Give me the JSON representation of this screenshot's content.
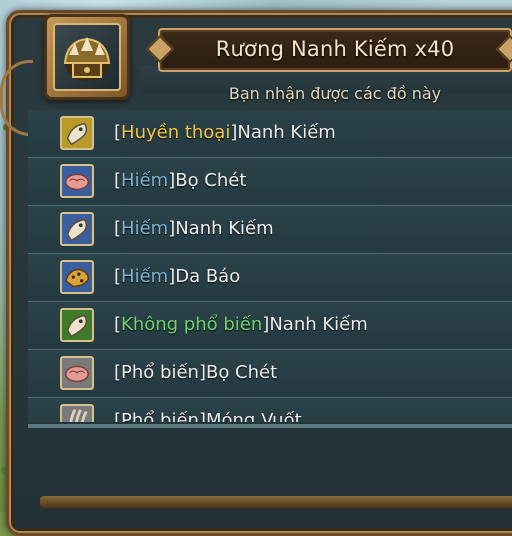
{
  "header": {
    "title": "Rương Nanh Kiếm x40",
    "subtitle": "Bạn nhận được các đồ này",
    "chest_icon": "chest-icon"
  },
  "colors": {
    "legendary": "#f2c94c",
    "rare": "#7fb3d5",
    "uncommon": "#6fd36f",
    "common": "#eeeeee"
  },
  "items": [
    {
      "rarity": "Huyền thoại",
      "name": "Nanh Kiếm",
      "rarity_color": "#f2c94c",
      "icon": "fang-icon",
      "icon_bg": "#b89a2a"
    },
    {
      "rarity": "Hiếm",
      "name": "Bọ Chét",
      "rarity_color": "#7fb3d5",
      "icon": "brain-icon",
      "icon_bg": "#3b5f9e"
    },
    {
      "rarity": "Hiếm",
      "name": "Nanh Kiếm",
      "rarity_color": "#7fb3d5",
      "icon": "fang-icon",
      "icon_bg": "#3b5f9e"
    },
    {
      "rarity": "Hiếm",
      "name": "Da Báo",
      "rarity_color": "#7fb3d5",
      "icon": "pelt-icon",
      "icon_bg": "#3b5f9e"
    },
    {
      "rarity": "Không phổ biến",
      "name": "Nanh Kiếm",
      "rarity_color": "#6fd36f",
      "icon": "fang-icon",
      "icon_bg": "#3d7a2a"
    },
    {
      "rarity": "Phổ biến",
      "name": "Bọ Chét",
      "rarity_color": "#eeeeee",
      "icon": "brain-icon",
      "icon_bg": "#7a7a7a"
    },
    {
      "rarity": "Phổ biến",
      "name": "Móng Vuốt",
      "rarity_color": "#eeeeee",
      "icon": "claw-icon",
      "icon_bg": "#7a7a7a"
    }
  ]
}
